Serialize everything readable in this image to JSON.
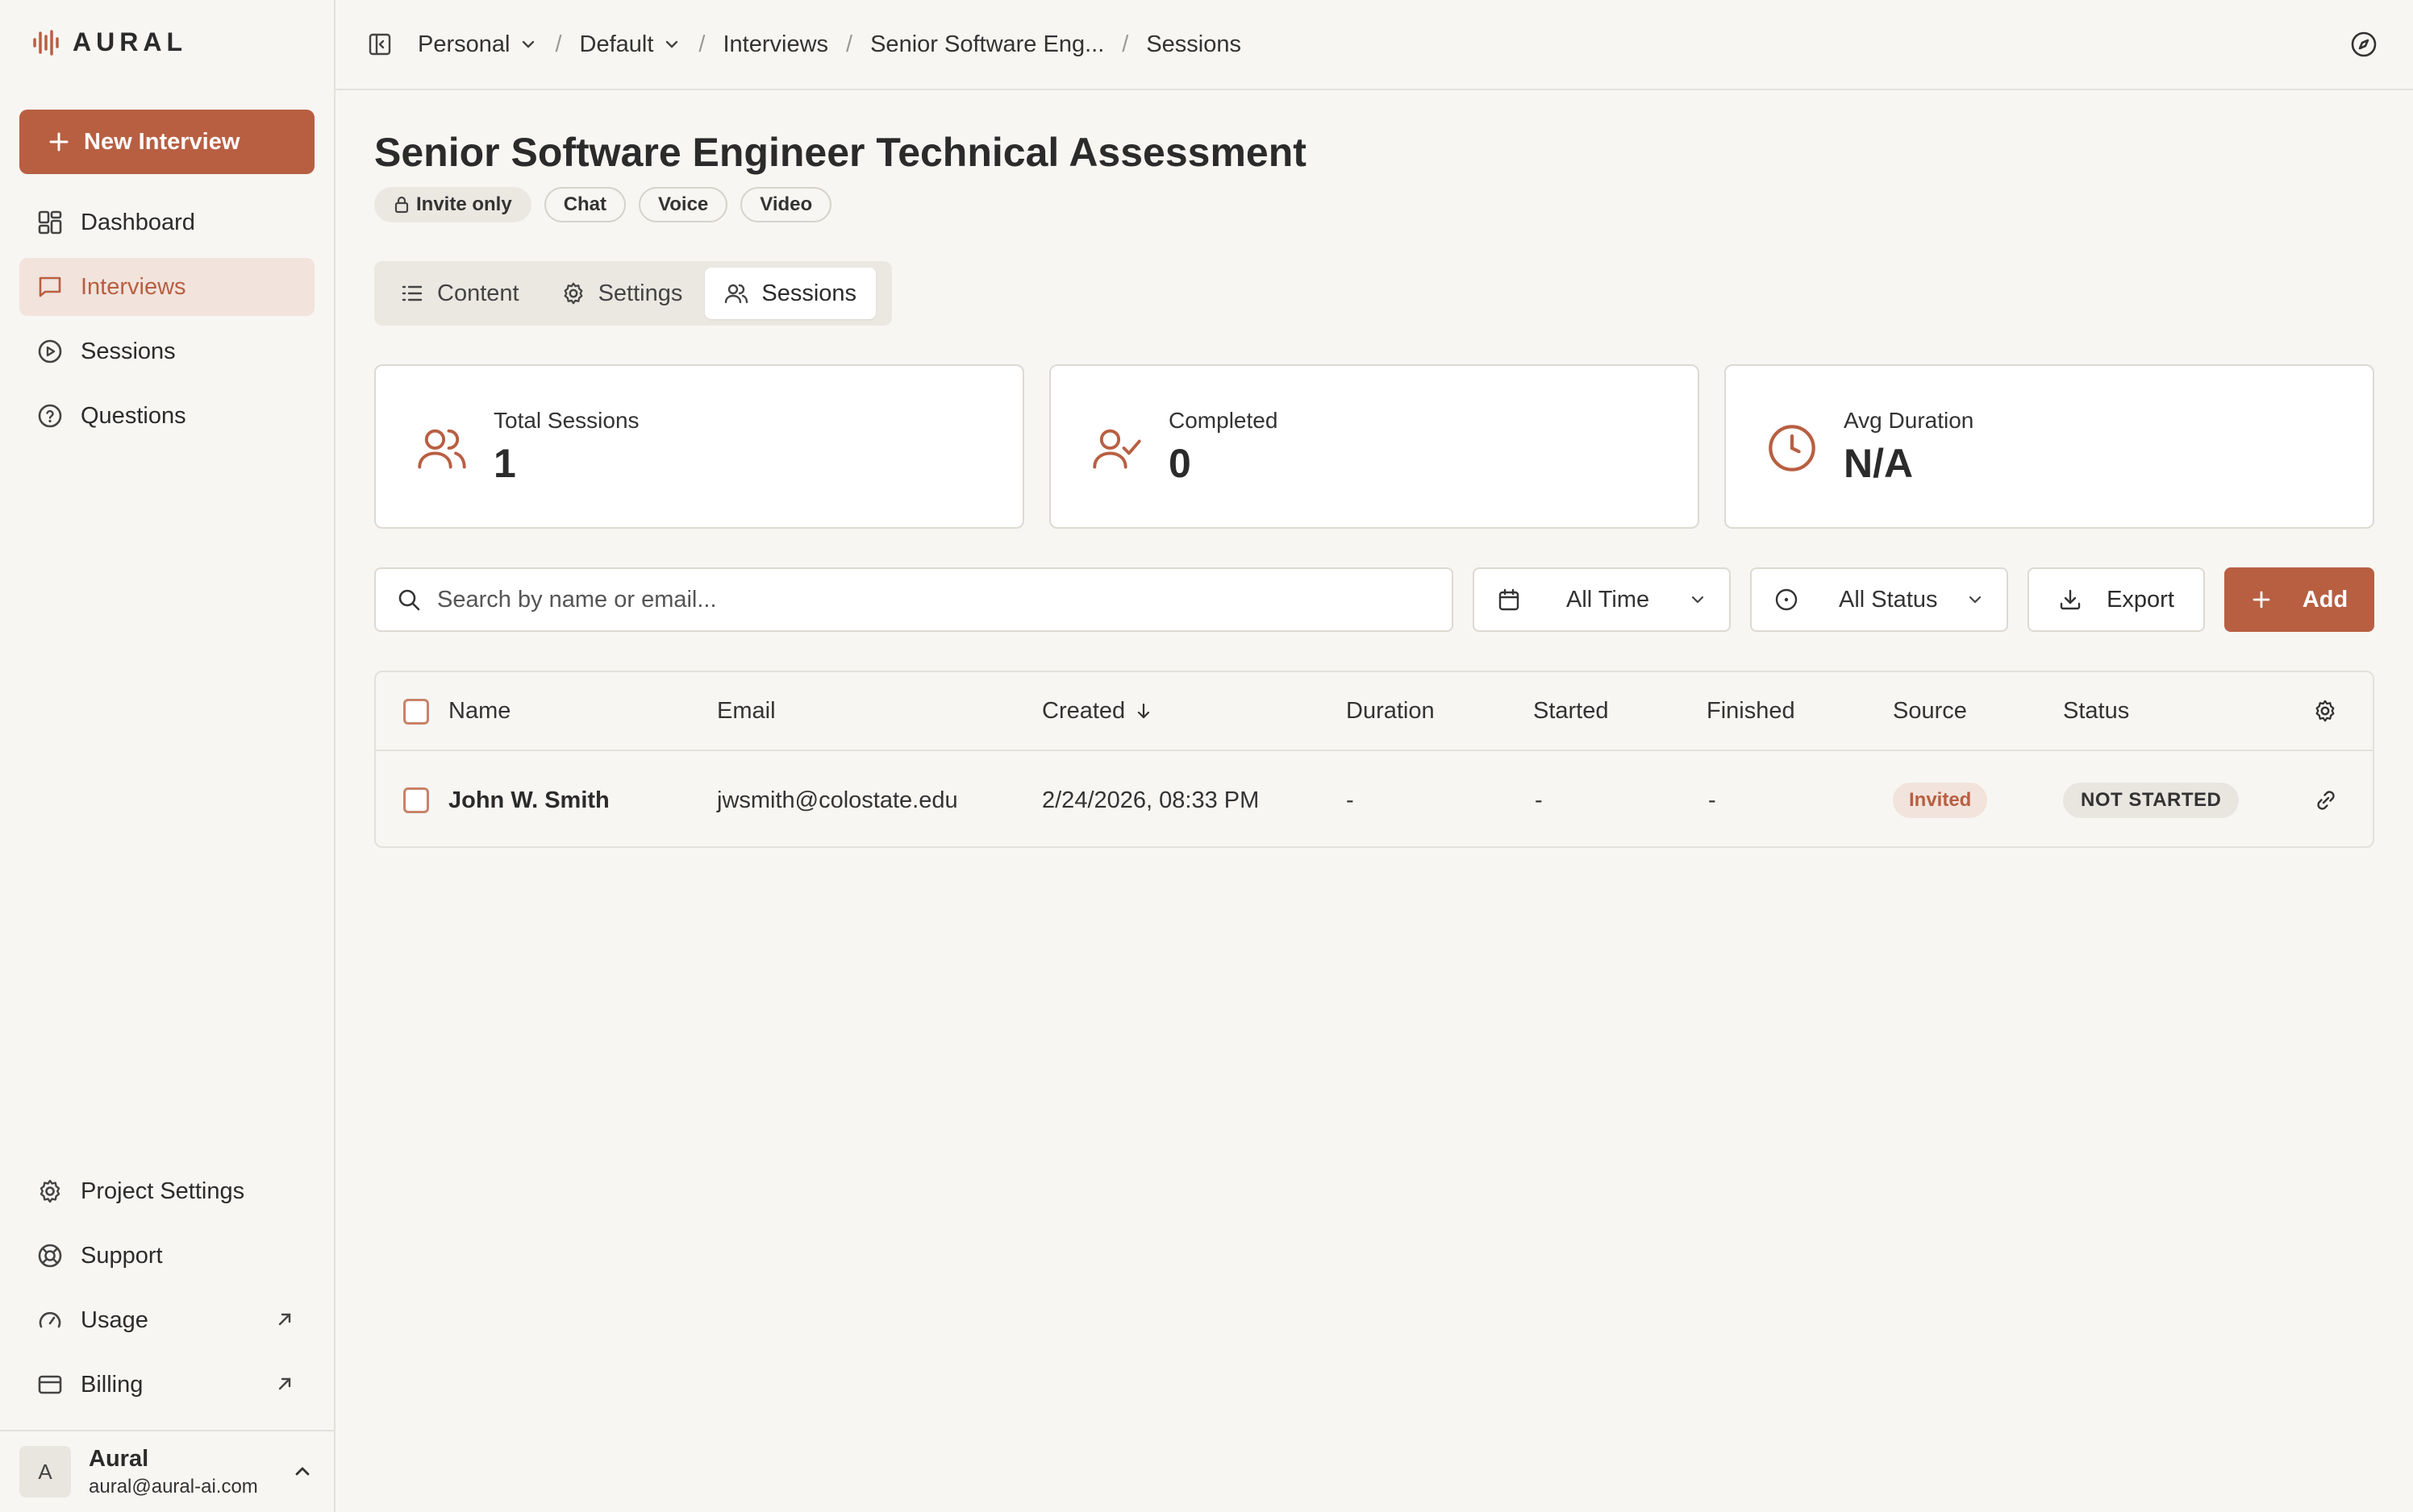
{
  "app": {
    "name": "AURAL"
  },
  "sidebar": {
    "new_button": "New Interview",
    "items": [
      {
        "label": "Dashboard",
        "icon": "dashboard-icon"
      },
      {
        "label": "Interviews",
        "icon": "message-square-icon",
        "active": true
      },
      {
        "label": "Sessions",
        "icon": "play-circle-icon"
      },
      {
        "label": "Questions",
        "icon": "help-circle-icon"
      }
    ],
    "bottom_items": [
      {
        "label": "Project Settings",
        "icon": "gear-icon"
      },
      {
        "label": "Support",
        "icon": "life-buoy-icon"
      },
      {
        "label": "Usage",
        "icon": "gauge-icon",
        "external": true
      },
      {
        "label": "Billing",
        "icon": "credit-card-icon",
        "external": true
      }
    ],
    "user": {
      "initial": "A",
      "name": "Aural",
      "email": "aural@aural-ai.com"
    }
  },
  "breadcrumb": {
    "workspace": "Personal",
    "project": "Default",
    "section": "Interviews",
    "interview": "Senior Software Eng...",
    "current": "Sessions"
  },
  "page": {
    "title": "Senior Software Engineer Technical Assessment",
    "tags": [
      "Invite only",
      "Chat",
      "Voice",
      "Video"
    ],
    "tabs": [
      {
        "label": "Content",
        "icon": "list-icon"
      },
      {
        "label": "Settings",
        "icon": "gear-icon"
      },
      {
        "label": "Sessions",
        "icon": "users-icon",
        "active": true
      }
    ]
  },
  "stats": [
    {
      "label": "Total Sessions",
      "value": "1",
      "icon": "users-icon"
    },
    {
      "label": "Completed",
      "value": "0",
      "icon": "user-check-icon"
    },
    {
      "label": "Avg Duration",
      "value": "N/A",
      "icon": "clock-icon"
    }
  ],
  "toolbar": {
    "search_placeholder": "Search by name or email...",
    "time_filter": "All Time",
    "status_filter": "All Status",
    "export_label": "Export",
    "add_label": "Add"
  },
  "table": {
    "columns": [
      "Name",
      "Email",
      "Created",
      "Duration",
      "Started",
      "Finished",
      "Source",
      "Status"
    ],
    "rows": [
      {
        "name": "John W. Smith",
        "email": "jwsmith@colostate.edu",
        "created": "2/24/2026, 08:33 PM",
        "duration": "-",
        "started": "-",
        "finished": "-",
        "source": "Invited",
        "status": "NOT STARTED"
      }
    ]
  },
  "colors": {
    "accent": "#b85f42",
    "accent_soft": "#f2e3dc",
    "background": "#f7f6f3"
  }
}
